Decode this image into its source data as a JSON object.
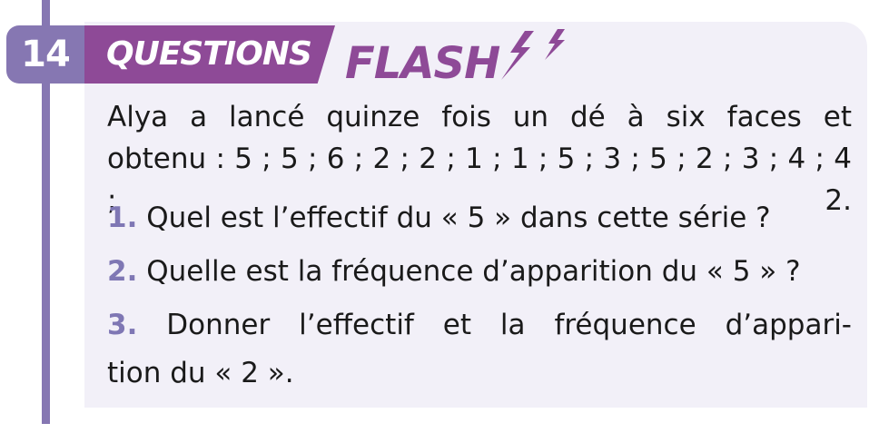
{
  "header": {
    "number": "14",
    "title": "QUESTIONS",
    "subtitle": "FLASH",
    "icon": "lightning-bolt-icon"
  },
  "intro": {
    "line1": "Alya a lancé quinze fois un dé à six faces et",
    "line2": "obtenu : 5 ; 5 ; 6 ; 2 ; 2 ; 1 ; 1 ; 5 ; 3 ; 5 ; 2 ; 3 ; 4 ; 4 ; 2."
  },
  "questions": [
    {
      "num": "1.",
      "text": "Quel est l’effectif du « 5 » dans cette série ?"
    },
    {
      "num": "2.",
      "text": "Quelle est la fréquence d’apparition du « 5 » ?"
    },
    {
      "num": "3.",
      "text": "Donner l’effectif et la fréquence d’appari-",
      "text_cont": "tion du « 2 »."
    }
  ],
  "colors": {
    "accent": "#8677b2",
    "banner": "#8e4a97",
    "panel": "#f2f0f8",
    "question_number": "#7f77b4"
  }
}
